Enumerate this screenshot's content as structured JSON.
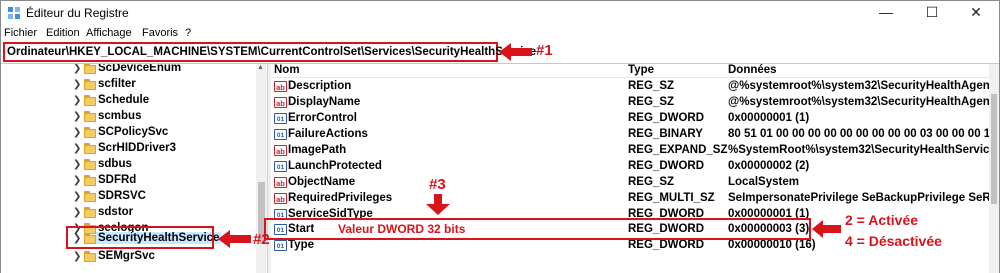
{
  "window": {
    "title": "Éditeur du Registre",
    "controls": {
      "minimize": "—",
      "maximize": "☐",
      "close": "✕"
    }
  },
  "menu": {
    "items": [
      "Fichier",
      "Edition",
      "Affichage",
      "Favoris",
      "?"
    ]
  },
  "address": {
    "path": "Ordinateur\\HKEY_LOCAL_MACHINE\\SYSTEM\\CurrentControlSet\\Services\\SecurityHealthService"
  },
  "tree": {
    "items": [
      {
        "label": "ScDeviceEnum",
        "selected": false
      },
      {
        "label": "scfilter",
        "selected": false
      },
      {
        "label": "Schedule",
        "selected": false
      },
      {
        "label": "scmbus",
        "selected": false
      },
      {
        "label": "SCPolicySvc",
        "selected": false
      },
      {
        "label": "ScrHIDDriver3",
        "selected": false
      },
      {
        "label": "sdbus",
        "selected": false
      },
      {
        "label": "SDFRd",
        "selected": false
      },
      {
        "label": "SDRSVC",
        "selected": false
      },
      {
        "label": "sdstor",
        "selected": false
      },
      {
        "label": "seclogon",
        "selected": false
      },
      {
        "label": "SecurityHealthService",
        "selected": true
      },
      {
        "label": "SEMgrSvc",
        "selected": false
      }
    ]
  },
  "values": {
    "columns": {
      "name": "Nom",
      "type": "Type",
      "data": "Données"
    },
    "rows": [
      {
        "icon": "ab",
        "name": "Description",
        "type": "REG_SZ",
        "data": "@%systemroot%\\system32\\SecurityHealthAgent.d"
      },
      {
        "icon": "ab",
        "name": "DisplayName",
        "type": "REG_SZ",
        "data": "@%systemroot%\\system32\\SecurityHealthAgent.d"
      },
      {
        "icon": "bin",
        "name": "ErrorControl",
        "type": "REG_DWORD",
        "data": "0x00000001 (1)"
      },
      {
        "icon": "bin",
        "name": "FailureActions",
        "type": "REG_BINARY",
        "data": "80 51 01 00 00 00 00 00 00 00 00 00 03 00 00 00 14"
      },
      {
        "icon": "ab",
        "name": "ImagePath",
        "type": "REG_EXPAND_SZ",
        "data": "%SystemRoot%\\system32\\SecurityHealthService.ex"
      },
      {
        "icon": "bin",
        "name": "LaunchProtected",
        "type": "REG_DWORD",
        "data": "0x00000002 (2)"
      },
      {
        "icon": "ab",
        "name": "ObjectName",
        "type": "REG_SZ",
        "data": "LocalSystem"
      },
      {
        "icon": "ab",
        "name": "RequiredPrivileges",
        "type": "REG_MULTI_SZ",
        "data": "SeImpersonatePrivilege SeBackupPrivilege SeResto"
      },
      {
        "icon": "bin",
        "name": "ServiceSidType",
        "type": "REG_DWORD",
        "data": "0x00000001 (1)"
      },
      {
        "icon": "bin",
        "name": "Start",
        "type": "REG_DWORD",
        "data": "0x00000003 (3)"
      },
      {
        "icon": "bin",
        "name": "Type",
        "type": "REG_DWORD",
        "data": "0x00000010 (16)"
      }
    ]
  },
  "annotations": {
    "marker1": "#1",
    "marker2": "#2",
    "marker3": "#3",
    "dword_note": "Valeur DWORD 32 bits",
    "active_note": "2 = Activée",
    "disabled_note": "4 = Désactivée",
    "color": "#d9131a"
  },
  "icons": {
    "app": "registry-editor-icon",
    "folder": "folder-icon",
    "string_value": "string-value-icon",
    "binary_value": "binary-value-icon",
    "chevron": "chevron-right-icon"
  }
}
